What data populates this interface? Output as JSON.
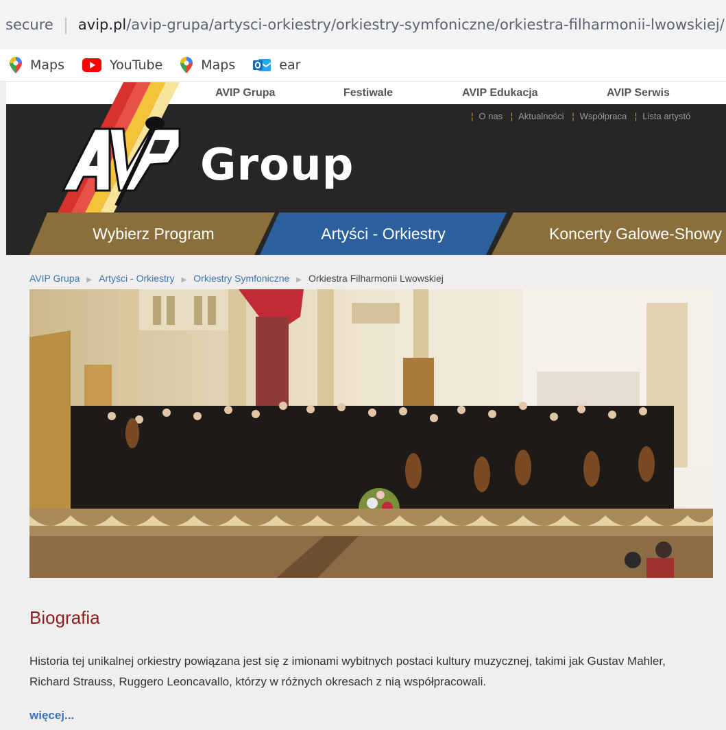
{
  "browser": {
    "security_label": "secure",
    "url_host": "avip.pl",
    "url_path": "/avip-grupa/artysci-orkiestry/orkiestry-symfoniczne/orkiestra-filharmonii-lwowskiej/",
    "bookmarks": [
      {
        "label": "Maps",
        "icon": "maps-icon"
      },
      {
        "label": "YouTube",
        "icon": "youtube-icon"
      },
      {
        "label": "Maps",
        "icon": "maps-icon"
      },
      {
        "label": "ear",
        "icon": "outlook-icon"
      }
    ]
  },
  "site": {
    "top_nav": [
      "AVIP Grupa",
      "Festiwale",
      "AVIP Edukacja",
      "AVIP Serwis"
    ],
    "sub_nav": [
      "O nas",
      "Aktualności",
      "Współpraca",
      "Lista artystó"
    ],
    "logo_word": "Group",
    "menu": [
      "Wybierz Program",
      "Artyści - Orkiestry",
      "Koncerty Galowe-Showy"
    ],
    "colors": {
      "gold": "#8a6f3a",
      "blue": "#2c5f9e",
      "dark": "#262626",
      "title_red": "#8b1e1e",
      "link_blue": "#3a74b7"
    }
  },
  "breadcrumb": [
    "AVIP Grupa",
    "Artyści - Orkiestry",
    "Orkiestry Symfoniczne",
    "Orkiestra Filharmonii Lwowskiej"
  ],
  "bio": {
    "title": "Biografia",
    "text": "Historia tej unikalnej orkiestry powiązana jest się z imionami wybitnych postaci kultury muzycznej, takimi jak Gustav Mahler, Richard Strauss, Ruggero Leoncavallo, którzy w różnych okresach z nią współpracowali.",
    "more": "więcej..."
  }
}
